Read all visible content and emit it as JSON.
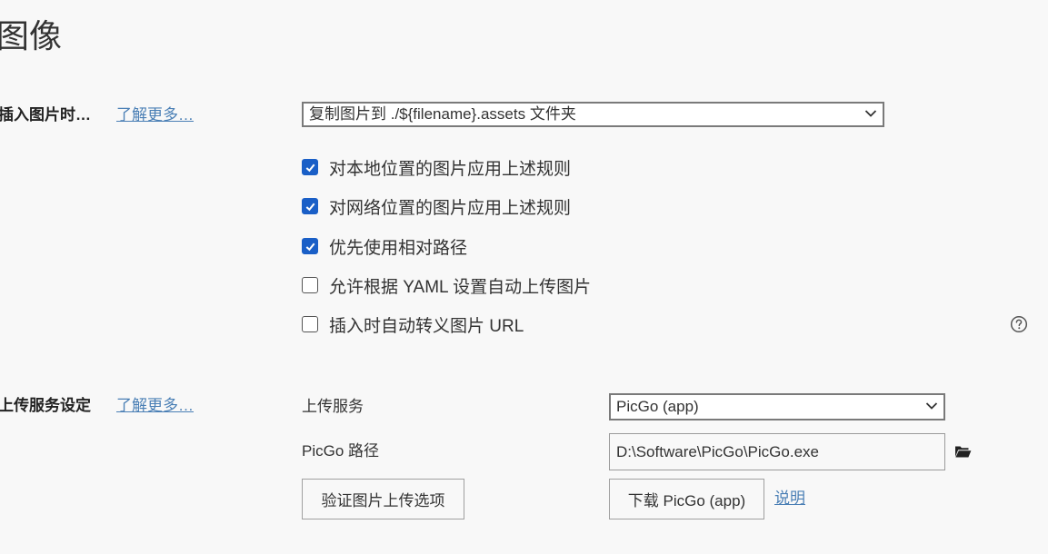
{
  "page": {
    "title": "图像"
  },
  "insert_section": {
    "label": "插入图片时…",
    "learn_more": "了解更多…",
    "select_value": "复制图片到 ./${filename}.assets 文件夹",
    "options": [
      {
        "label": "对本地位置的图片应用上述规则",
        "checked": true
      },
      {
        "label": "对网络位置的图片应用上述规则",
        "checked": true
      },
      {
        "label": "优先使用相对路径",
        "checked": true
      },
      {
        "label": "允许根据 YAML 设置自动上传图片",
        "checked": false
      },
      {
        "label": "插入时自动转义图片 URL",
        "checked": false
      }
    ],
    "help_icon": "question-circle-icon"
  },
  "upload_section": {
    "label": "上传服务设定",
    "learn_more": "了解更多…",
    "service_label": "上传服务",
    "service_value": "PicGo (app)",
    "path_label": "PicGo 路径",
    "path_value": "D:\\Software\\PicGo\\PicGo.exe",
    "folder_icon": "folder-open-icon",
    "validate_button": "验证图片上传选项",
    "download_button": "下载 PicGo (app)",
    "help_link": "说明"
  },
  "colors": {
    "background": "#f8f8f8",
    "checkbox_checked": "#1a5fc7",
    "link": "#4a7fb5",
    "text": "#333333"
  }
}
